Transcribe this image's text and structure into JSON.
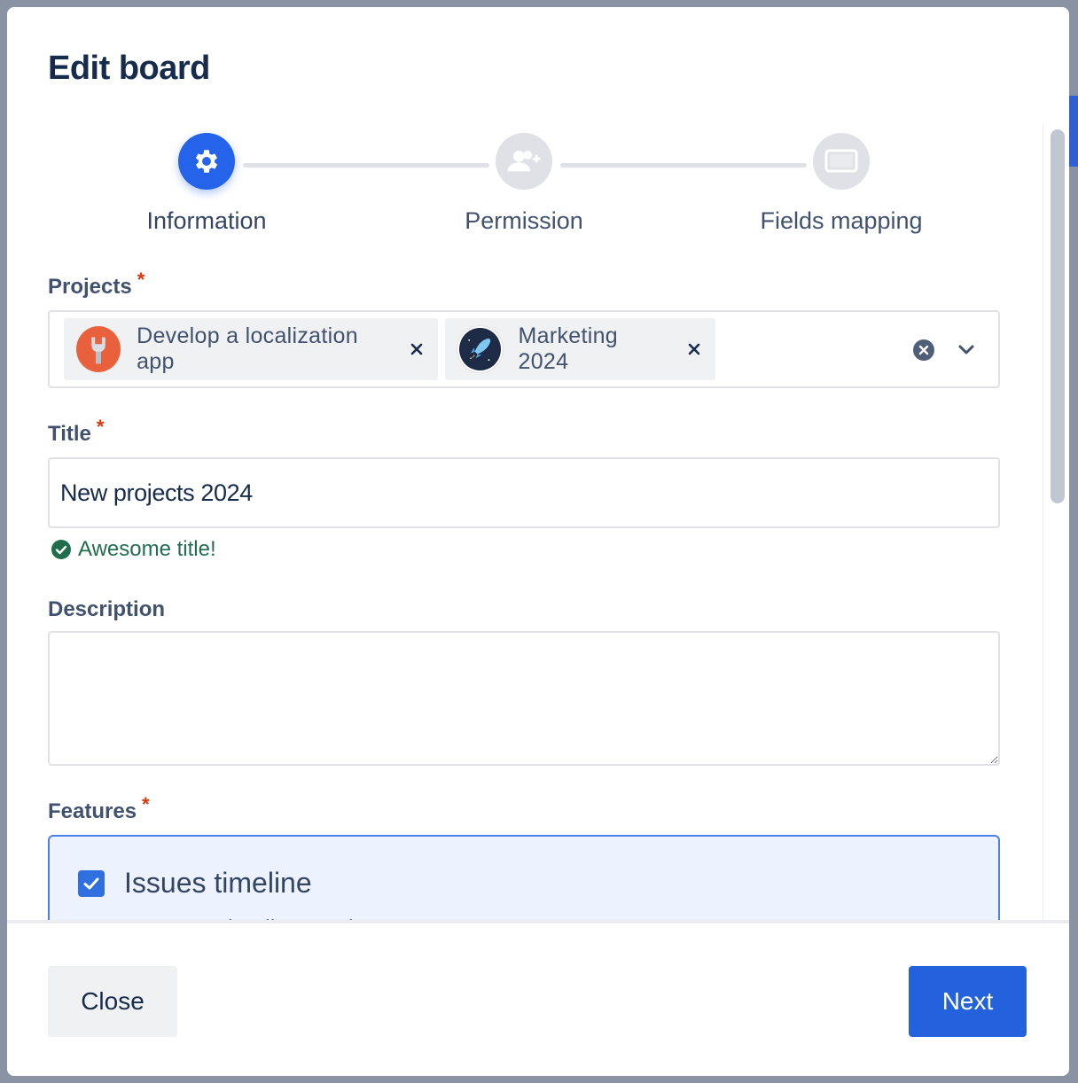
{
  "modal": {
    "title": "Edit board"
  },
  "stepper": {
    "steps": [
      {
        "label": "Information",
        "icon": "gear-icon",
        "active": true
      },
      {
        "label": "Permission",
        "icon": "add-user-icon",
        "active": false
      },
      {
        "label": "Fields mapping",
        "icon": "monitor-icon",
        "active": false
      }
    ]
  },
  "projects": {
    "label": "Projects",
    "required_mark": "*",
    "selected": [
      {
        "name": "Develop a localization app",
        "icon": "wrench-icon"
      },
      {
        "name": "Marketing 2024",
        "icon": "rocket-icon"
      }
    ],
    "remove_glyph": "×"
  },
  "title_field": {
    "label": "Title",
    "required_mark": "*",
    "value": "New projects 2024",
    "helper": "Awesome title!"
  },
  "description_field": {
    "label": "Description",
    "value": ""
  },
  "features": {
    "label": "Features",
    "required_mark": "*",
    "items": [
      {
        "title": "Issues timeline",
        "subtitle": "Features timeline roadmap",
        "checked": true
      }
    ]
  },
  "footer": {
    "close_label": "Close",
    "next_label": "Next"
  },
  "colors": {
    "primary": "#2462DD",
    "success": "#216E4E",
    "required": "#DE350B"
  }
}
